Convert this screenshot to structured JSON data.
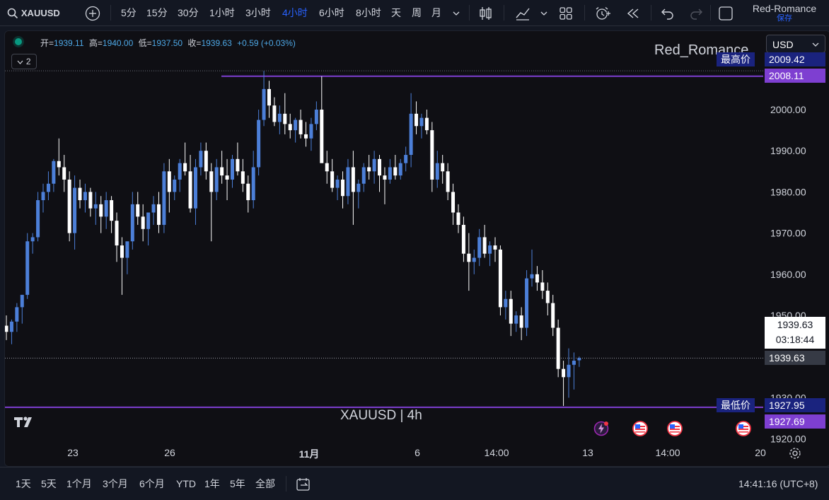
{
  "toolbar": {
    "symbol": "XAUUSD",
    "intervals": [
      "5分",
      "15分",
      "30分",
      "1小时",
      "3小时",
      "4小时",
      "6小时",
      "8小时",
      "天",
      "周",
      "月"
    ],
    "active_interval": "4小时",
    "user_name": "Red-Romance",
    "save_label": "保存"
  },
  "legend": {
    "open_label": "开",
    "open": "1939.11",
    "high_label": "高",
    "high": "1940.00",
    "low_label": "低",
    "low": "1937.50",
    "close_label": "收",
    "close": "1939.63",
    "change": "+0.59 (+0.03%)",
    "collapse_count": "2"
  },
  "currency": "USD",
  "watermark_user": "Red_Romance",
  "symbol_watermark": "XAUUSD | 4h",
  "price_labels": {
    "highest_label": "最高价",
    "highest_value": "2009.42",
    "line_top_value": "2008.11",
    "current_price": "1939.63",
    "countdown": "03:18:44",
    "current_price_line": "1939.63",
    "lowest_label": "最低价",
    "lowest_value": "1927.95",
    "line_bottom_value": "1927.69"
  },
  "y_axis_ticks": [
    "2000.00",
    "1990.00",
    "1980.00",
    "1970.00",
    "1960.00",
    "1950.00",
    "1930.00",
    "1920.00"
  ],
  "x_axis_ticks": [
    "23",
    "26",
    "11月",
    "6",
    "14:00",
    "13",
    "14:00",
    "20"
  ],
  "bottom_bar": {
    "ranges": [
      "1天",
      "5天",
      "1个月",
      "3个月",
      "6个月",
      "YTD",
      "1年",
      "5年",
      "全部"
    ],
    "clock": "14:41:16 (UTC+8)"
  },
  "colors": {
    "up": "#4c7fd8",
    "down": "#ffffff",
    "accent": "#2962ff",
    "line": "#7e3fd1",
    "bg": "#0f0f14"
  },
  "chart_data": {
    "type": "candlestick",
    "title": "XAUUSD | 4h",
    "xlabel": "",
    "ylabel": "",
    "ylim": [
      1918,
      2012
    ],
    "candles": [
      [
        1947.5,
        1950,
        1944,
        1946
      ],
      [
        1946,
        1949,
        1943,
        1948.5
      ],
      [
        1948.5,
        1953,
        1946,
        1952
      ],
      [
        1952,
        1955,
        1948,
        1955
      ],
      [
        1955,
        1970,
        1954,
        1968
      ],
      [
        1968,
        1970,
        1965,
        1969
      ],
      [
        1969,
        1980,
        1968,
        1978
      ],
      [
        1978,
        1982,
        1975,
        1980
      ],
      [
        1980,
        1985,
        1978,
        1982
      ],
      [
        1982,
        1988,
        1980,
        1987.5
      ],
      [
        1987.5,
        1993,
        1984,
        1986
      ],
      [
        1986,
        1989,
        1980,
        1983
      ],
      [
        1983,
        1985,
        1968,
        1970
      ],
      [
        1970,
        1984,
        1966,
        1981
      ],
      [
        1981,
        1983,
        1976,
        1978
      ],
      [
        1978,
        1982,
        1975,
        1980
      ],
      [
        1980,
        1981,
        1974,
        1976
      ],
      [
        1976,
        1980,
        1972,
        1977
      ],
      [
        1977,
        1979,
        1970,
        1974
      ],
      [
        1974,
        1980,
        1971,
        1978
      ],
      [
        1978,
        1979,
        1970,
        1973
      ],
      [
        1973,
        1975,
        1963,
        1967
      ],
      [
        1967,
        1969,
        1955,
        1964
      ],
      [
        1964,
        1966,
        1960,
        1968
      ],
      [
        1968,
        1980,
        1966,
        1977
      ],
      [
        1977,
        1980,
        1972,
        1974
      ],
      [
        1974,
        1977,
        1968,
        1971
      ],
      [
        1971,
        1975,
        1967,
        1975
      ],
      [
        1975,
        1979,
        1972,
        1977
      ],
      [
        1977,
        1980,
        1970,
        1972
      ],
      [
        1972,
        1987,
        1970,
        1985
      ],
      [
        1985,
        1988,
        1975,
        1980
      ],
      [
        1980,
        1984,
        1978,
        1983
      ],
      [
        1983,
        1988,
        1980,
        1987
      ],
      [
        1987,
        1992,
        1984,
        1985
      ],
      [
        1985,
        1989,
        1975,
        1976
      ],
      [
        1976,
        1988,
        1972,
        1986
      ],
      [
        1986,
        1992,
        1984,
        1990
      ],
      [
        1990,
        1992,
        1983,
        1985
      ],
      [
        1985,
        1987,
        1968,
        1980
      ],
      [
        1980,
        1988,
        1978,
        1986
      ],
      [
        1986,
        1990,
        1982,
        1984
      ],
      [
        1984,
        1988,
        1978,
        1983
      ],
      [
        1983,
        1989,
        1981,
        1988
      ],
      [
        1988,
        1992,
        1984,
        1985
      ],
      [
        1985,
        1988,
        1980,
        1982
      ],
      [
        1982,
        1984,
        1975,
        1978
      ],
      [
        1978,
        1990,
        1976,
        1986
      ],
      [
        1986,
        2000,
        1984,
        1997.5
      ],
      [
        1997.5,
        2009.4,
        1996,
        2005
      ],
      [
        2005,
        2007,
        1998,
        2001
      ],
      [
        2001,
        2003,
        1996,
        1997
      ],
      [
        1997,
        2001,
        1994,
        1999
      ],
      [
        1999,
        2004,
        1994,
        1996.5
      ],
      [
        1996.5,
        1999,
        1993,
        1995
      ],
      [
        1995,
        1998,
        1992,
        1997.5
      ],
      [
        1997.5,
        2000,
        1993,
        1994
      ],
      [
        1994,
        1997,
        1991,
        1993
      ],
      [
        1993,
        1998,
        1990,
        1996.5
      ],
      [
        1996.5,
        2002,
        1995,
        2000
      ],
      [
        2000,
        2008.1,
        1994,
        1987
      ],
      [
        1987,
        1990,
        1982,
        1985
      ],
      [
        1985,
        1988,
        1980,
        1981
      ],
      [
        1981,
        1984,
        1978,
        1983
      ],
      [
        1983,
        1985,
        1976,
        1979
      ],
      [
        1979,
        1988,
        1977,
        1986
      ],
      [
        1986,
        1990,
        1972,
        1980
      ],
      [
        1980,
        1983,
        1976,
        1982
      ],
      [
        1982,
        1987,
        1980,
        1986
      ],
      [
        1986,
        1989,
        1983,
        1985
      ],
      [
        1985,
        1990,
        1982,
        1988
      ],
      [
        1988,
        1989,
        1980,
        1984
      ],
      [
        1984,
        1986,
        1977,
        1983
      ],
      [
        1983,
        1988,
        1982,
        1986
      ],
      [
        1986,
        1989,
        1983,
        1984
      ],
      [
        1984,
        1988,
        1983,
        1987
      ],
      [
        1987,
        1991,
        1985,
        1989
      ],
      [
        1989,
        2004,
        1986,
        1999
      ],
      [
        1999,
        2002,
        1994,
        1996
      ],
      [
        1996,
        1999,
        1993,
        1998
      ],
      [
        1998,
        2000,
        1994,
        1995
      ],
      [
        1995,
        1997,
        1980,
        1983
      ],
      [
        1983,
        1990,
        1981,
        1987
      ],
      [
        1987,
        1989,
        1982,
        1985
      ],
      [
        1985,
        1987,
        1978,
        1980
      ],
      [
        1980,
        1982,
        1972,
        1975
      ],
      [
        1975,
        1977,
        1970,
        1972
      ],
      [
        1972,
        1974,
        1963,
        1965
      ],
      [
        1965,
        1970,
        1956,
        1963
      ],
      [
        1963,
        1966,
        1960,
        1964
      ],
      [
        1964,
        1971,
        1962,
        1969
      ],
      [
        1969,
        1972,
        1964,
        1965
      ],
      [
        1965,
        1968,
        1962,
        1967
      ],
      [
        1967,
        1969,
        1963,
        1966
      ],
      [
        1966,
        1967,
        1950,
        1952
      ],
      [
        1952,
        1956,
        1949,
        1954
      ],
      [
        1954,
        1956,
        1945,
        1948
      ],
      [
        1948,
        1951,
        1946,
        1950
      ],
      [
        1950,
        1952,
        1944,
        1947
      ],
      [
        1947,
        1961,
        1945,
        1959
      ],
      [
        1959,
        1966,
        1957,
        1960
      ],
      [
        1960,
        1962,
        1956,
        1958
      ],
      [
        1958,
        1961,
        1954,
        1956
      ],
      [
        1956,
        1958,
        1950,
        1953
      ],
      [
        1953,
        1955,
        1945,
        1947
      ],
      [
        1947,
        1949,
        1935,
        1937
      ],
      [
        1937,
        1939,
        1928,
        1935
      ],
      [
        1935,
        1942,
        1930,
        1938
      ],
      [
        1938,
        1941,
        1932,
        1939
      ],
      [
        1939.1,
        1940,
        1937.5,
        1939.63
      ]
    ],
    "horizontal_lines": [
      2008.11,
      1927.69
    ],
    "highest": 2009.42,
    "lowest": 1927.95,
    "last_price": 1939.63
  }
}
